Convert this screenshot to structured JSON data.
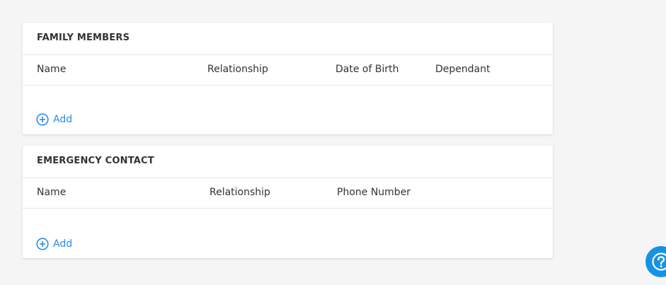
{
  "family_members": {
    "title": "FAMILY MEMBERS",
    "columns": [
      "Name",
      "Relationship",
      "Date of Birth",
      "Dependant"
    ],
    "add_label": "Add"
  },
  "emergency_contact": {
    "title": "EMERGENCY CONTACT",
    "columns": [
      "Name",
      "Relationship",
      "Phone Number"
    ],
    "add_label": "Add"
  },
  "icons": {
    "add": "plus-circle-icon",
    "help": "question-mark-icon"
  },
  "colors": {
    "accent": "#2b8ce6",
    "help_button": "#1592e6",
    "background": "#f5f5f5"
  }
}
